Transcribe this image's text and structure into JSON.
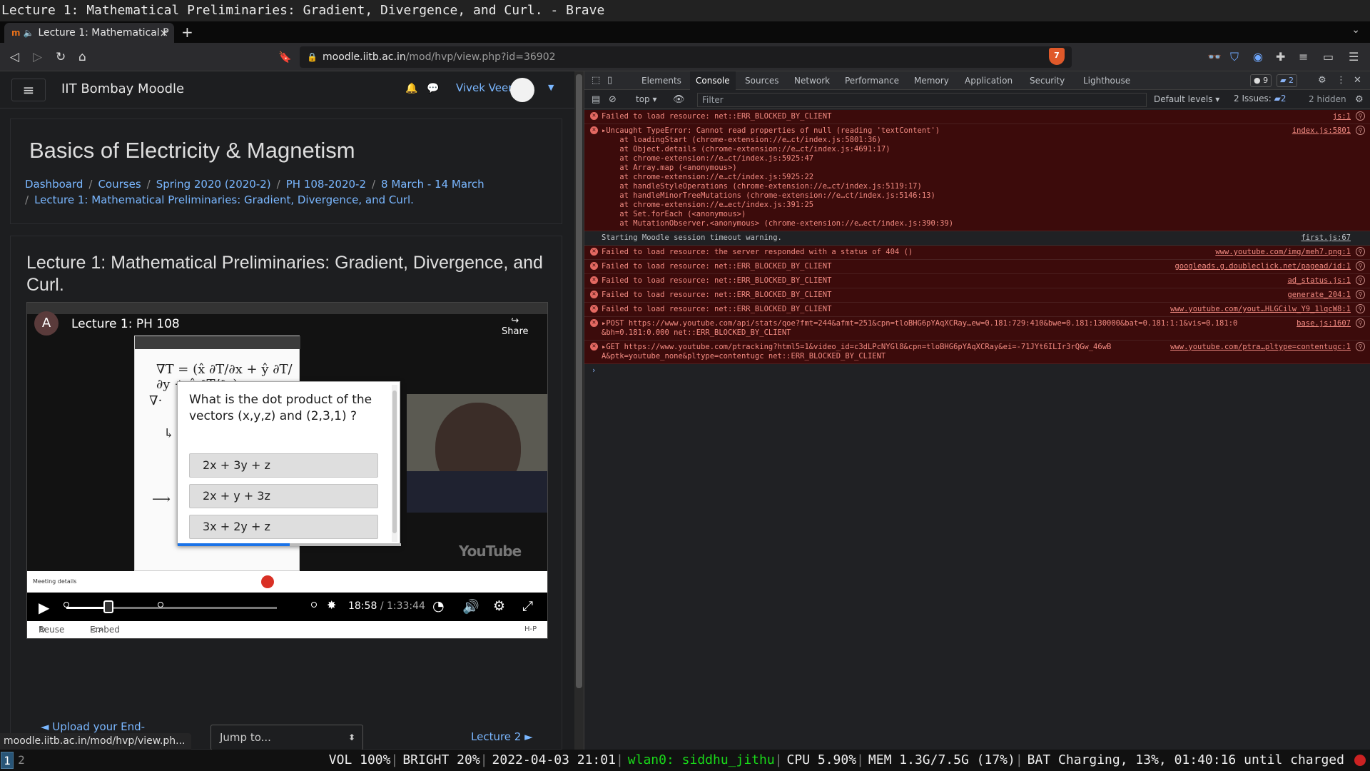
{
  "window_title": "Lecture 1: Mathematical Preliminaries: Gradient, Divergence, and Curl. - Brave",
  "tab": {
    "favicon": "m",
    "label": "Lecture 1: Mathematical P",
    "close": "×"
  },
  "new_tab": "+",
  "url": {
    "host": "moodle.iitb.ac.in",
    "path": "/mod/hvp/view.php?id=36902"
  },
  "brave_count": "7",
  "navbar": {
    "site_name": "IIT Bombay Moodle",
    "user_name": "Vivek Veer"
  },
  "course": {
    "title": "Basics of Electricity & Magnetism",
    "breadcrumb": [
      "Dashboard",
      "Courses",
      "Spring 2020 (2020-2)",
      "PH 108-2020-2",
      "8 March - 14 March"
    ],
    "breadcrumb_last": "Lecture 1: Mathematical Preliminaries: Gradient, Divergence, and Curl."
  },
  "lecture_title": "Lecture 1: Mathematical Preliminaries: Gradient, Divergence, and Curl.",
  "video": {
    "channel_initial": "A",
    "title": "Lecture 1: PH 108",
    "share": "Share",
    "meeting_details": "Meeting details",
    "youtube": "YouTube",
    "current_time": "18:58",
    "total_time": "/ 1:33:44",
    "progress": 0.2
  },
  "quiz": {
    "question": "What is the dot product of the vectors (x,y,z) and (2,3,1) ?",
    "answers": [
      "2x + 3y + z",
      "2x + y + 3z",
      "3x + 2y + z"
    ],
    "progress": 0.5
  },
  "actions": {
    "reuse": "Reuse",
    "embed": "Embed",
    "hp": "H-P"
  },
  "pagenav": {
    "prev": "◄ Upload your End-semester re-exam answer-script here",
    "jump": "Jump to...",
    "next": "Lecture 2 ►"
  },
  "hover_url": "moodle.iitb.ac.in/mod/hvp/view.ph...",
  "devtools": {
    "tabs": [
      "Elements",
      "Console",
      "Sources",
      "Network",
      "Performance",
      "Memory",
      "Application",
      "Security",
      "Lighthouse"
    ],
    "errors_badge": "9",
    "messages_badge": "2",
    "context": "top",
    "filter_placeholder": "Filter",
    "levels": "Default levels",
    "issues": "2 Issues:",
    "issues_count": "2",
    "hidden": "2 hidden",
    "log": [
      {
        "type": "error",
        "text": "Failed to load resource: net::ERR_BLOCKED_BY_CLIENT",
        "src": "js:1"
      },
      {
        "type": "error",
        "text": "▸Uncaught TypeError: Cannot read properties of null (reading 'textContent')\n    at loadingStart (chrome-extension://e…ct/index.js:5801:36)\n    at Object.details (chrome-extension://e…ct/index.js:4691:17)\n    at chrome-extension://e…ct/index.js:5925:47\n    at Array.map (<anonymous>)\n    at chrome-extension://e…ct/index.js:5925:22\n    at handleStyleOperations (chrome-extension://e…ct/index.js:5119:17)\n    at handleMinorTreeMutations (chrome-extension://e…ct/index.js:5146:13)\n    at chrome-extension://e…ect/index.js:391:25\n    at Set.forEach (<anonymous>)\n    at MutationObserver.<anonymous> (chrome-extension://e…ect/index.js:390:39)",
        "src": "index.js:5801"
      },
      {
        "type": "info",
        "text": "Starting Moodle session timeout warning.",
        "src": "first.js:67"
      },
      {
        "type": "error",
        "text": "Failed to load resource: the server responded with a status of 404 ()",
        "src": "www.youtube.com/img/meh7.png:1"
      },
      {
        "type": "error",
        "text": "Failed to load resource: net::ERR_BLOCKED_BY_CLIENT",
        "src": "googleads.g.doubleclick.net/pagead/id:1"
      },
      {
        "type": "error",
        "text": "Failed to load resource: net::ERR_BLOCKED_BY_CLIENT",
        "src": "ad_status.js:1"
      },
      {
        "type": "error",
        "text": "Failed to load resource: net::ERR_BLOCKED_BY_CLIENT",
        "src": "generate_204:1"
      },
      {
        "type": "error",
        "text": "Failed to load resource: net::ERR_BLOCKED_BY_CLIENT",
        "src": "www.youtube.com/yout…HLGCilw_Y9_1lqcW8:1"
      },
      {
        "type": "error",
        "text": "▸POST https://www.youtube.com/api/stats/qoe?fmt=244&afmt=251&cpn=tloBHG6pYAqXCRay…ew=0.181:729:410&bwe=0.181:130000&bat=0.181:1:1&vis=0.181:0\n&bh=0.181:0.000 net::ERR_BLOCKED_BY_CLIENT",
        "src": "base.js:1607"
      },
      {
        "type": "error",
        "text": "▸GET https://www.youtube.com/ptracking?html5=1&video_id=c3dLPcNYGl8&cpn=tloBHG6pYAqXCRay&ei=-71JYt6ILIr3rQGw_46wB\nA&ptk=youtube_none&pltype=contentugc net::ERR_BLOCKED_BY_CLIENT",
        "src": "www.youtube.com/ptra…pltype=contentugc:1"
      }
    ]
  },
  "statusbar": {
    "workspaces": [
      "1",
      "2"
    ],
    "vol": "VOL 100%",
    "bright": "BRIGHT 20%",
    "datetime": "2022-04-03 21:01",
    "wlan": "wlan0: siddhu_jithu",
    "cpu": "CPU 5.90%",
    "mem": "MEM 1.3G/7.5G (17%)",
    "bat": "BAT Charging, 13%, 01:40:16 until charged"
  }
}
